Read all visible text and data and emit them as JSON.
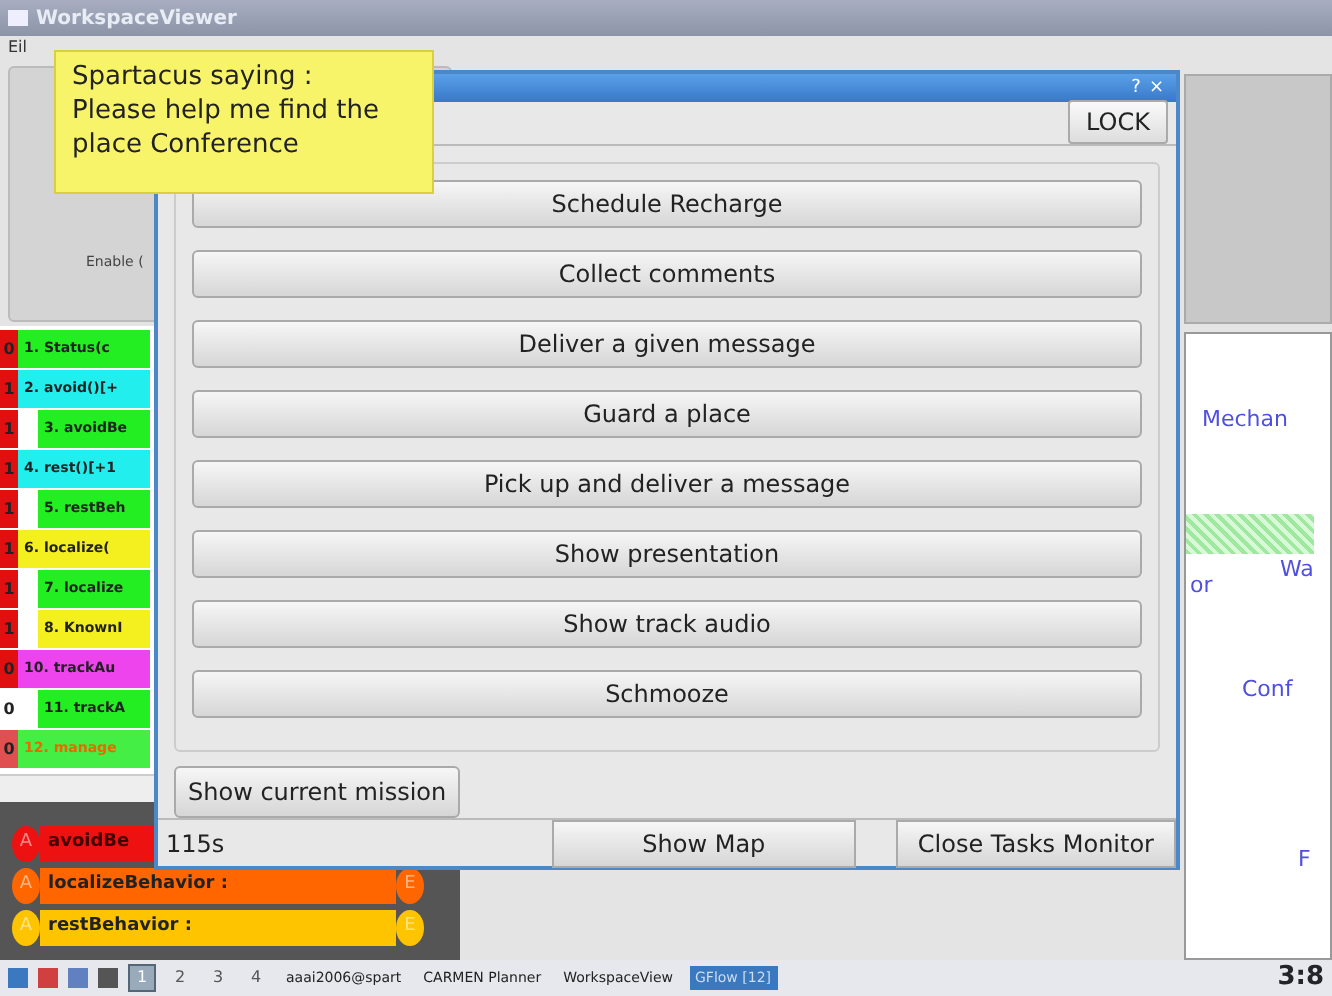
{
  "window": {
    "title": "WorkspaceViewer",
    "menu": [
      "Eil"
    ]
  },
  "left_panel": {
    "label": "Enable ("
  },
  "behaviors": [
    {
      "flag": {
        "text": "0",
        "color": "#e01010"
      },
      "label": "1. Status(c",
      "color": "#22ee22",
      "kind": "plain"
    },
    {
      "flag": {
        "text": "1",
        "color": "#e01010"
      },
      "label": "2. avoid()[+",
      "color": "#22eeee",
      "kind": "plain",
      "children": [
        {
          "flag": {
            "text": "1",
            "color": "#e01010"
          },
          "label": "3. avoidBe",
          "color": "#22ee22",
          "kind": "plain"
        }
      ]
    },
    {
      "flag": {
        "text": "1",
        "color": "#e01010"
      },
      "label": "4. rest()[+1",
      "color": "#22eeee",
      "kind": "plain",
      "children": [
        {
          "flag": {
            "text": "1",
            "color": "#e01010"
          },
          "label": "5. restBeh",
          "color": "#22ee22",
          "kind": "plain"
        }
      ]
    },
    {
      "flag": {
        "text": "1",
        "color": "#e01010"
      },
      "label": "6. localize(",
      "color": "#f4f020",
      "kind": "plain",
      "children": [
        {
          "flag": {
            "text": "1",
            "color": "#e01010"
          },
          "label": "7. localize",
          "color": "#22ee22",
          "kind": "plain"
        },
        {
          "flag": {
            "text": "1",
            "color": "#e01010"
          },
          "label": "8. KnownI",
          "color": "#f4f020",
          "kind": "plain"
        }
      ]
    },
    {
      "flag": {
        "text": "0",
        "color": "#e01010"
      },
      "label": "10. trackAu",
      "color": "#ee44ee",
      "kind": "plain",
      "children": [
        {
          "flag": {
            "text": "0",
            "color": "#ffffff"
          },
          "label": "11. trackA",
          "color": "#22ee22",
          "kind": "plain"
        }
      ]
    },
    {
      "flag": {
        "text": "0",
        "color": "#e05050"
      },
      "label": "12. manage",
      "color": "#44ee44",
      "kind": "warning"
    }
  ],
  "timeline": [
    {
      "start": "A",
      "label": "avoidBe",
      "color": "#ee1111"
    },
    {
      "start": "A",
      "label": "localizeBehavior :",
      "color": "#ff6600",
      "end": "E"
    },
    {
      "start": "A",
      "label": "restBehavior :",
      "color": "#ffc400",
      "end": "E"
    }
  ],
  "map": {
    "labels": [
      {
        "text": "Mechan",
        "kind": "room"
      },
      {
        "text": "or",
        "kind": "room"
      },
      {
        "text": "Wa",
        "kind": "room"
      },
      {
        "text": "Conf",
        "kind": "room"
      },
      {
        "text": "F",
        "kind": "room"
      }
    ]
  },
  "tooltip": {
    "text": "Spartacus saying :\nPlease help me find the\nplace Conference"
  },
  "dialog": {
    "title_buttons": [
      "?",
      "×"
    ],
    "lock": "LOCK",
    "tasks": [
      "Schedule Recharge",
      "Collect comments",
      "Deliver a given message",
      "Guard a place",
      "Pick up and deliver a message",
      "Show presentation",
      "Show track audio",
      "Schmooze"
    ],
    "current_mission": "Show current mission",
    "elapsed": "115s",
    "show_map": "Show Map",
    "close": "Close Tasks Monitor"
  },
  "taskbar": {
    "desktops": [
      {
        "label": "1",
        "selected": true
      },
      {
        "label": "2",
        "selected": false
      },
      {
        "label": "3",
        "selected": false
      },
      {
        "label": "4",
        "selected": false
      }
    ],
    "tasks": [
      {
        "label": "aaai2006@spart",
        "selected": false
      },
      {
        "label": "CARMEN Planner",
        "selected": false
      },
      {
        "label": "WorkspaceView",
        "selected": false
      },
      {
        "label": "GFlow [12]",
        "selected": true
      }
    ],
    "clock": "3:8"
  }
}
